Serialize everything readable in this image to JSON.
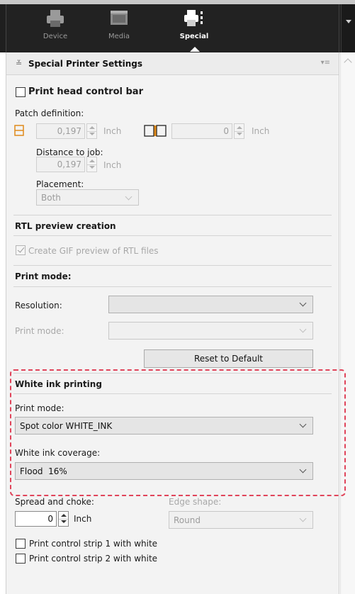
{
  "toolbar": {
    "tabs": [
      {
        "label": "Device",
        "icon": "printer-icon"
      },
      {
        "label": "Media",
        "icon": "media-icon"
      },
      {
        "label": "Special",
        "icon": "special-printer-icon"
      }
    ]
  },
  "section": {
    "title": "Special Printer Settings"
  },
  "print_head": {
    "checkbox_label": "Print head control bar",
    "patch_label": "Patch definition:",
    "patch_width": "0,197",
    "patch_width_unit": "Inch",
    "patch_gap": "0",
    "patch_gap_unit": "Inch",
    "distance_label": "Distance to job:",
    "distance_value": "0,197",
    "distance_unit": "Inch",
    "placement_label": "Placement:",
    "placement_value": "Both"
  },
  "rtl": {
    "title": "RTL preview creation",
    "checkbox_label": "Create GIF preview of RTL files"
  },
  "print_mode": {
    "title": "Print mode:",
    "resolution_label": "Resolution:",
    "resolution_value": "",
    "mode_label": "Print mode:",
    "mode_value": "",
    "reset_label": "Reset to Default"
  },
  "white_ink": {
    "title": "White ink printing",
    "mode_label": "Print mode:",
    "mode_value": "Spot color WHITE_INK",
    "coverage_label": "White ink coverage:",
    "coverage_value": "Flood  16%"
  },
  "spread": {
    "label": "Spread and choke:",
    "value": "0",
    "unit": "Inch",
    "edge_label": "Edge shape:",
    "edge_value": "Round"
  },
  "strips": {
    "strip1": "Print control strip 1 with white",
    "strip2": "Print control strip 2 with white"
  },
  "colors": {
    "toolbar_bg": "#1f1f1f",
    "panel_bg": "#f3f3f3",
    "highlight": "#e0445a"
  }
}
